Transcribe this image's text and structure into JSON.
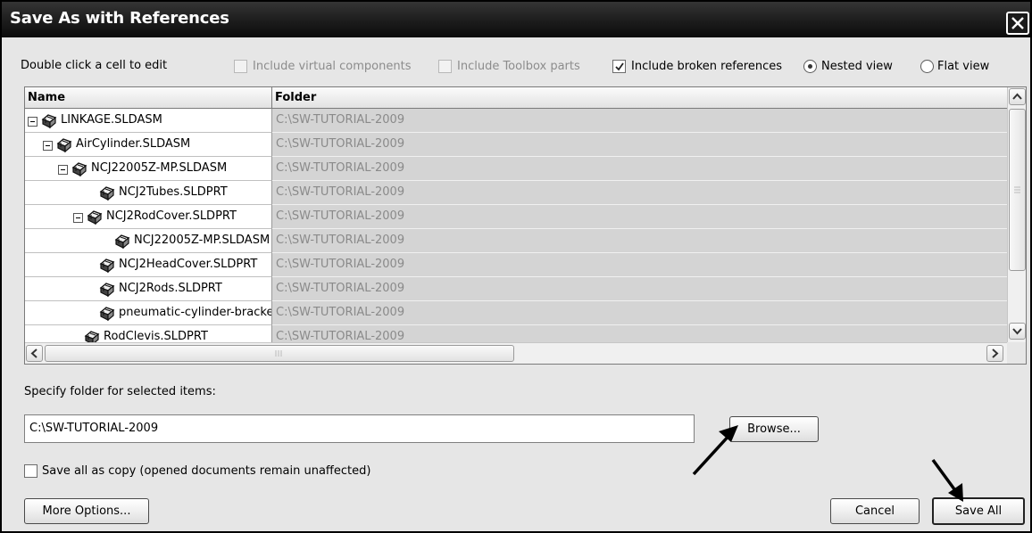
{
  "window": {
    "title": "Save As with References",
    "close_icon": "close-icon"
  },
  "toolbar": {
    "hint": "Double click a cell to edit",
    "include_virtual": {
      "label": "Include virtual components",
      "checked": false,
      "enabled": false
    },
    "include_toolbox": {
      "label": "Include Toolbox parts",
      "checked": false,
      "enabled": false
    },
    "include_broken": {
      "label": "Include broken references",
      "checked": true,
      "enabled": true
    },
    "nested_view": {
      "label": "Nested view",
      "selected": true
    },
    "flat_view": {
      "label": "Flat view",
      "selected": false
    }
  },
  "grid": {
    "columns": [
      "Name",
      "Folder"
    ],
    "rows": [
      {
        "name": "LINKAGE.SLDASM",
        "folder": "C:\\SW-TUTORIAL-2009",
        "level": 0,
        "expander": true
      },
      {
        "name": "AirCylinder.SLDASM",
        "folder": "C:\\SW-TUTORIAL-2009",
        "level": 1,
        "expander": true
      },
      {
        "name": "NCJ22005Z-MP.SLDASM",
        "folder": "C:\\SW-TUTORIAL-2009",
        "level": 2,
        "expander": true
      },
      {
        "name": "NCJ2Tubes.SLDPRT",
        "folder": "C:\\SW-TUTORIAL-2009",
        "level": 3,
        "expander": false
      },
      {
        "name": "NCJ2RodCover.SLDPRT",
        "folder": "C:\\SW-TUTORIAL-2009",
        "level": 3,
        "expander": true
      },
      {
        "name": "NCJ22005Z-MP.SLDASM",
        "folder": "C:\\SW-TUTORIAL-2009",
        "level": 4,
        "expander": false
      },
      {
        "name": "NCJ2HeadCover.SLDPRT",
        "folder": "C:\\SW-TUTORIAL-2009",
        "level": 3,
        "expander": false
      },
      {
        "name": "NCJ2Rods.SLDPRT",
        "folder": "C:\\SW-TUTORIAL-2009",
        "level": 3,
        "expander": false
      },
      {
        "name": "pneumatic-cylinder-bracket.S",
        "folder": "C:\\SW-TUTORIAL-2009",
        "level": 3,
        "expander": false
      },
      {
        "name": "RodClevis.SLDPRT",
        "folder": "C:\\SW-TUTORIAL-2009",
        "level": 2,
        "expander": false
      }
    ]
  },
  "folder_section": {
    "label": "Specify folder for selected items:",
    "value": "C:\\SW-TUTORIAL-2009",
    "browse_label": "Browse..."
  },
  "options": {
    "save_copy_label": "Save all as copy (opened documents remain unaffected)",
    "save_copy_checked": false
  },
  "buttons": {
    "more_options": "More Options...",
    "cancel": "Cancel",
    "save_all": "Save All"
  }
}
